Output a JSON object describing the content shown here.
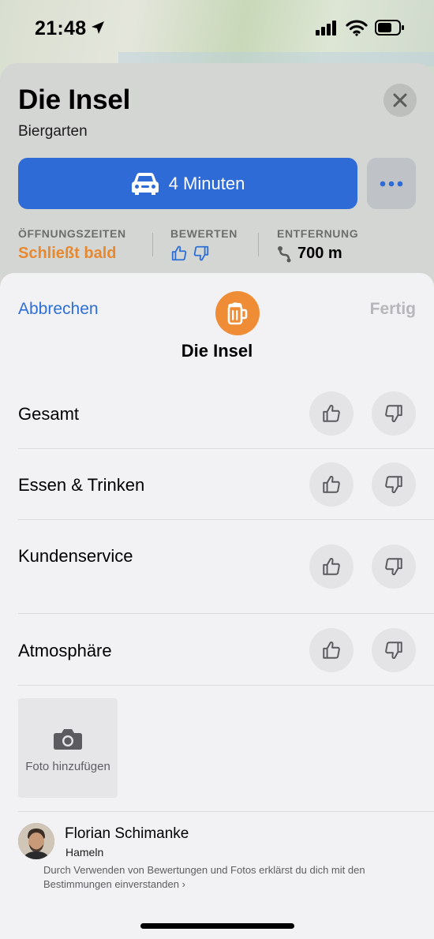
{
  "status_bar": {
    "time": "21:48"
  },
  "place": {
    "title": "Die Insel",
    "category": "Biergarten",
    "route": {
      "label": "4 Minuten"
    },
    "info": {
      "hours_label": "ÖFFNUNGSZEITEN",
      "hours_value": "Schließt bald",
      "rate_label": "BEWERTEN",
      "distance_label": "ENTFERNUNG",
      "distance_value": "700 m"
    }
  },
  "rating_sheet": {
    "cancel": "Abbrechen",
    "done": "Fertig",
    "title": "Die Insel",
    "rows": [
      {
        "label": "Gesamt"
      },
      {
        "label": "Essen & Trinken"
      },
      {
        "label": "Kundenservice"
      },
      {
        "label": "Atmosphäre"
      }
    ],
    "photo_label": "Foto hinzufügen",
    "user": {
      "name": "Florian Schimanke",
      "city": "Hameln"
    },
    "terms": "Durch Verwenden von Bewertungen und Fotos erklärst du dich mit den Bestimmungen einverstanden",
    "terms_chevron": "›"
  },
  "colors": {
    "accent_blue": "#2f6bd6",
    "link_blue": "#2d6fd8",
    "orange": "#e8882f",
    "beer_badge": "#ee8d35"
  }
}
